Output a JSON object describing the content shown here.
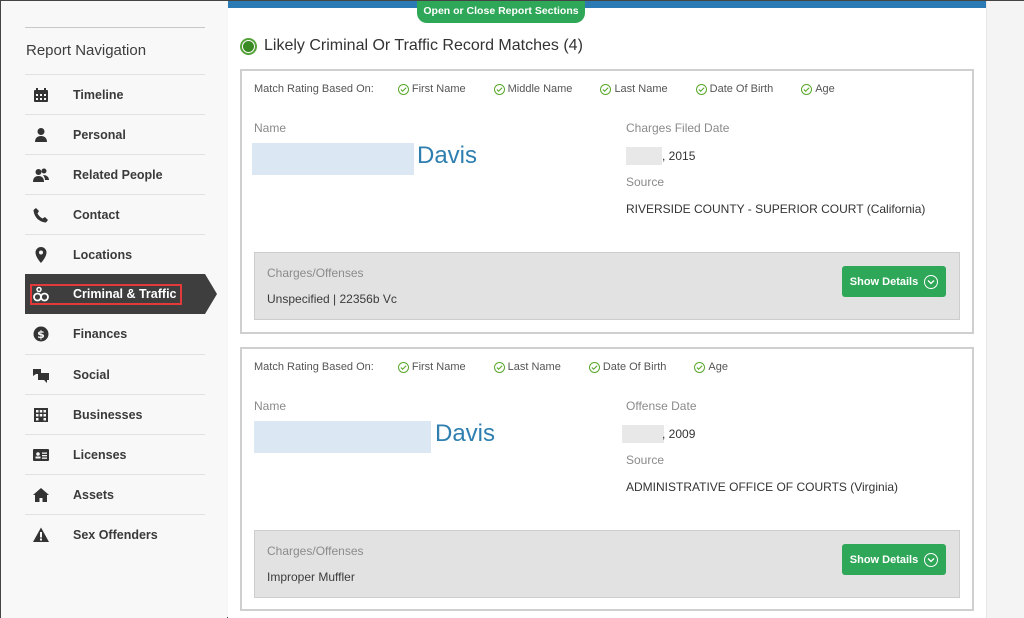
{
  "sidebar": {
    "title": "Report Navigation",
    "items": [
      {
        "label": "Timeline",
        "icon": "calendar-icon"
      },
      {
        "label": "Personal",
        "icon": "person-icon"
      },
      {
        "label": "Related People",
        "icon": "people-icon"
      },
      {
        "label": "Contact",
        "icon": "phone-icon"
      },
      {
        "label": "Locations",
        "icon": "map-pin-icon"
      },
      {
        "label": "Criminal & Traffic",
        "icon": "handcuffs-icon",
        "active": true
      },
      {
        "label": "Finances",
        "icon": "dollar-icon"
      },
      {
        "label": "Social",
        "icon": "chat-icon"
      },
      {
        "label": "Businesses",
        "icon": "building-icon"
      },
      {
        "label": "Licenses",
        "icon": "id-card-icon"
      },
      {
        "label": "Assets",
        "icon": "home-icon"
      },
      {
        "label": "Sex Offenders",
        "icon": "warning-icon"
      }
    ]
  },
  "main": {
    "toggle_label": "Open or Close Report Sections",
    "section_title": "Likely Criminal Or Traffic Record Matches (4)",
    "colors": {
      "accent_green": "#2fa758",
      "top_bar": "#2c7ab3",
      "name_blue": "#2e7fb0"
    },
    "records": [
      {
        "match_label": "Match Rating Based On:",
        "match_criteria": [
          "First Name",
          "Middle Name",
          "Last Name",
          "Date Of Birth",
          "Age"
        ],
        "name_label": "Name",
        "last_name": "Davis",
        "date_label": "Charges Filed Date",
        "date_value": ", 2015",
        "source_label": "Source",
        "source_value": "RIVERSIDE COUNTY - SUPERIOR COURT (California)",
        "charges_label": "Charges/Offenses",
        "charges_value": "Unspecified | 22356b Vc",
        "button_label": "Show Details"
      },
      {
        "match_label": "Match Rating Based On:",
        "match_criteria": [
          "First Name",
          "Last Name",
          "Date Of Birth",
          "Age"
        ],
        "name_label": "Name",
        "last_name": "Davis",
        "date_label": "Offense Date",
        "date_value": ", 2009",
        "source_label": "Source",
        "source_value": "ADMINISTRATIVE OFFICE OF COURTS (Virginia)",
        "charges_label": "Charges/Offenses",
        "charges_value": "Improper Muffler",
        "button_label": "Show Details"
      }
    ]
  }
}
